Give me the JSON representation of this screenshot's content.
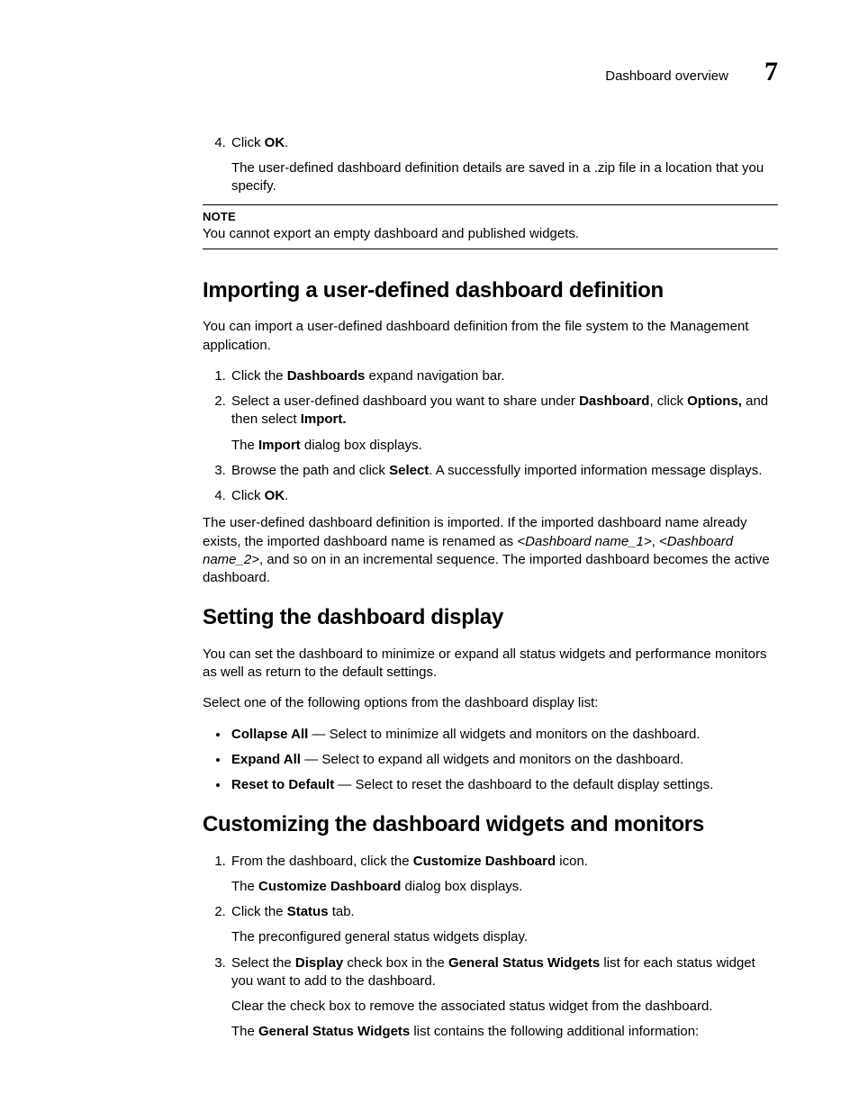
{
  "header": {
    "title": "Dashboard overview",
    "chapter_number": "7"
  },
  "step_ok": {
    "marker": "4.",
    "prefix": "Click ",
    "bold": "OK",
    "suffix": ".",
    "sub": "The user-defined dashboard definition details are saved in a .zip file in a location that you specify."
  },
  "note": {
    "label": "NOTE",
    "text": "You cannot export an empty dashboard and published widgets."
  },
  "sec_import": {
    "heading": "Importing a user-defined dashboard definition",
    "intro": "You can import a user-defined dashboard definition from the file system to the Management application.",
    "step1": {
      "pre": "Click the ",
      "b1": "Dashboards",
      "post": " expand navigation bar."
    },
    "step2": {
      "pre": "Select a user-defined dashboard you want to share under ",
      "b1": "Dashboard",
      "mid1": ", click ",
      "b2": "Options,",
      "mid2": " and then select ",
      "b3": "Import.",
      "sub_pre": "The ",
      "sub_b": "Import",
      "sub_post": " dialog box displays."
    },
    "step3": {
      "pre": "Browse the path and click ",
      "b1": "Select",
      "post": ". A successfully imported information message displays."
    },
    "step4": {
      "pre": "Click ",
      "b1": "OK",
      "post": "."
    },
    "trail_pre": "The user-defined dashboard definition is imported. If the imported dashboard name already exists, the imported dashboard name is renamed as ",
    "trail_i1": "<Dashboard name_1>",
    "trail_mid": ", ",
    "trail_i2": "<Dashboard name_2>",
    "trail_post": ", and so on in an incremental sequence. The imported dashboard becomes the active dashboard."
  },
  "sec_setting": {
    "heading": "Setting the dashboard display",
    "intro": "You can set the dashboard to minimize or expand all status widgets and performance monitors as well as return to the default settings.",
    "lead": "Select one of the following options from the dashboard display list:",
    "items": [
      {
        "b": "Collapse All",
        "rest": "Select to minimize all widgets and monitors on the dashboard."
      },
      {
        "b": "Expand All",
        "rest": "Select to expand all widgets and monitors on the dashboard."
      },
      {
        "b": "Reset to Default",
        "rest": "Select to reset the dashboard to the default display settings."
      }
    ]
  },
  "sec_custom": {
    "heading": "Customizing the dashboard widgets and monitors",
    "step1": {
      "pre": "From the dashboard, click the ",
      "b1": "Customize Dashboard",
      "post": " icon.",
      "sub_pre": "The ",
      "sub_b": "Customize Dashboard",
      "sub_post": " dialog box displays."
    },
    "step2": {
      "pre": "Click the ",
      "b1": "Status",
      "post": " tab.",
      "sub": "The preconfigured general status widgets display."
    },
    "step3": {
      "pre": "Select the ",
      "b1": "Display",
      "mid1": " check box in the ",
      "b2": "General Status Widgets",
      "post": " list for each status widget you want to add to the dashboard.",
      "sub1": "Clear the check box to remove the associated status widget from the dashboard.",
      "sub2_pre": "The ",
      "sub2_b": "General Status Widgets",
      "sub2_post": " list contains the following additional information:"
    }
  }
}
